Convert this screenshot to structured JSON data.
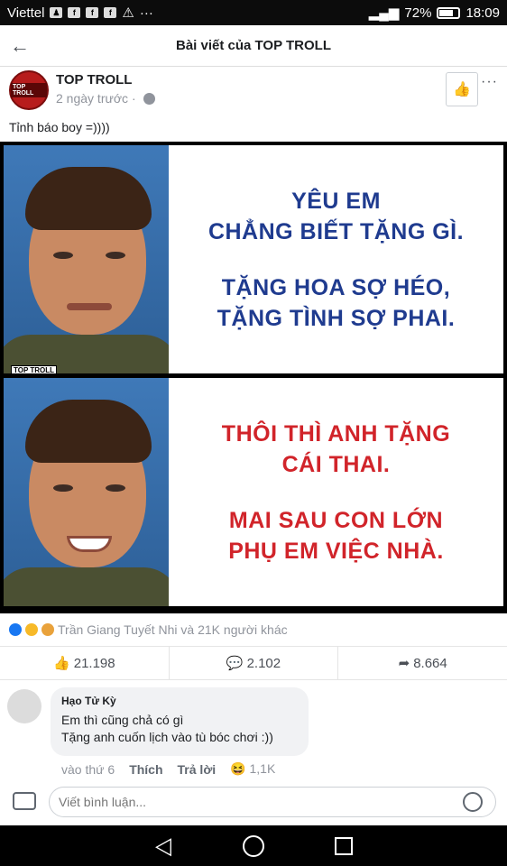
{
  "statusbar": {
    "carrier": "Viettel",
    "battery": "72%",
    "time": "18:09",
    "battery_level": 0.72
  },
  "appbar": {
    "title": "Bài viết của TOP TROLL"
  },
  "post": {
    "page_name": "TOP TROLL",
    "avatar_text": "TOP TROLL",
    "time": "2 ngày trước",
    "caption": "Tỉnh báo boy =))))",
    "meme": {
      "watermark": "TOP TROLL",
      "top_lines": [
        "YÊU EM",
        "CHẲNG BIẾT TẶNG GÌ.",
        "TẶNG HOA SỢ HÉO,",
        "TẶNG TÌNH SỢ PHAI."
      ],
      "bottom_lines": [
        "THÔI THÌ ANH TẶNG",
        "CÁI THAI.",
        "MAI SAU CON LỚN",
        "PHỤ EM VIỆC NHÀ."
      ]
    },
    "reactions_text": "Trần Giang Tuyết Nhi và 21K người khác",
    "likes": "21.198",
    "comments": "2.102",
    "shares": "8.664"
  },
  "comment": {
    "author": "Hạo Tử Kỳ",
    "line1": "Em thì cũng chả có gì",
    "line2": "Tặng anh cuốn lịch vào tù bóc chơi :))",
    "time": "vào thứ 6",
    "like_label": "Thích",
    "reply_label": "Trả lời",
    "reaction_count": "1,1K"
  },
  "composer": {
    "placeholder": "Viết bình luận..."
  },
  "colors": {
    "blue_text": "#1f3b8f",
    "red_text": "#d1242a",
    "like_blue": "#1877f2"
  }
}
